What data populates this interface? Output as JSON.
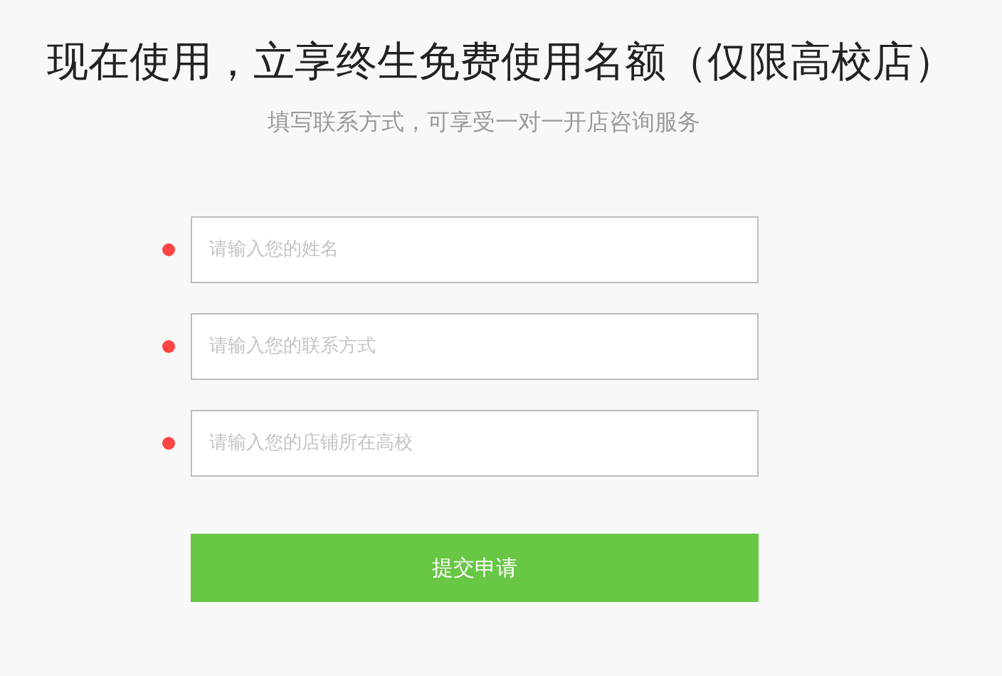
{
  "title": "现在使用，立享终生免费使用名额（仅限高校店）",
  "subtitle": "填写联系方式，可享受一对一开店咨询服务",
  "fields": [
    {
      "placeholder": "请输入您的姓名",
      "required": true
    },
    {
      "placeholder": "请输入您的联系方式",
      "required": true
    },
    {
      "placeholder": "请输入您的店铺所在高校",
      "required": true
    }
  ],
  "submit": "提交申请"
}
